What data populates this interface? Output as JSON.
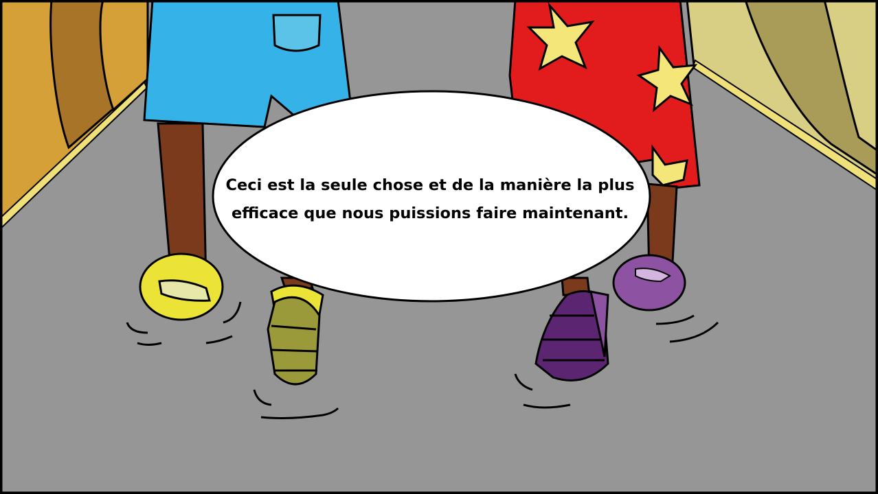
{
  "speech_bubble": {
    "text": "Ceci est la seule chose et de la manière la plus efficace que nous puissions faire maintenant."
  },
  "colors": {
    "road": "#969696",
    "left_tunnel": "#d5a038",
    "right_tunnel": "#d8cf84",
    "blue_shorts": "#35b3e8",
    "red_shorts": "#e21c1c",
    "stars": "#f5e67a",
    "skin": "#7a3a1b",
    "yellow_shoe": "#ece337",
    "olive_shoe": "#9a9a3a",
    "purple_shoe": "#8e52a3",
    "dark_purple_shoe": "#5b2572"
  }
}
